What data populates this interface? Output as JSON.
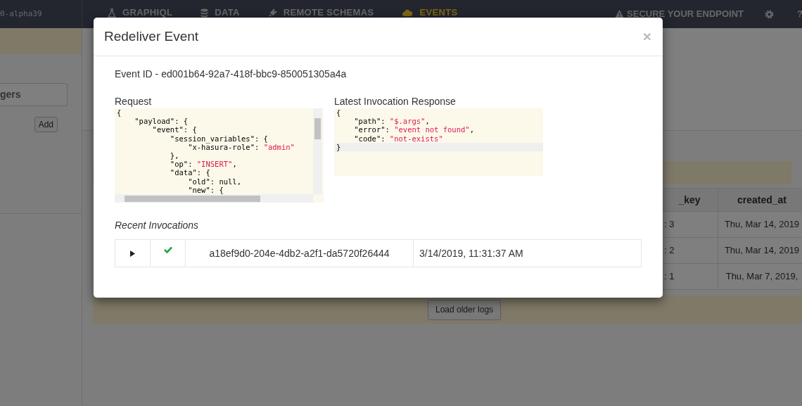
{
  "navbar": {
    "version": "0-alpha39",
    "items": [
      {
        "label": "GRAPHIQL",
        "kind": "flask",
        "selected": false
      },
      {
        "label": "DATA",
        "kind": "database",
        "selected": false
      },
      {
        "label": "REMOTE SCHEMAS",
        "kind": "plug",
        "selected": false
      },
      {
        "label": "EVENTS",
        "kind": "cloud",
        "selected": true
      }
    ],
    "secure_link": "SECURE YOUR ENDPOINT",
    "help": "?"
  },
  "sidebar": {
    "search_text": "gers",
    "add_button": "Add"
  },
  "events_table": {
    "columns": [
      "_key",
      "created_at"
    ],
    "rows": [
      [
        ": 3",
        "Thu, Mar 14, 2019"
      ],
      [
        ": 2",
        "Thu, Mar 14, 2019"
      ],
      [
        ": 1",
        "Thu, Mar 7, 2019, "
      ]
    ],
    "load_button": "Load older logs"
  },
  "modal": {
    "title": "Redeliver Event",
    "close": "×",
    "event_id": "Event ID - ed001b64-92a7-418f-bbc9-850051305a4a",
    "request_label": "Request",
    "request_lines": [
      {
        "active": false,
        "parts": [
          {
            "kind": "plain",
            "text": "{"
          }
        ]
      },
      {
        "active": false,
        "parts": [
          {
            "kind": "plain",
            "text": "    \"payload\": {"
          }
        ]
      },
      {
        "active": false,
        "parts": [
          {
            "kind": "plain",
            "text": "        \"event\": {"
          }
        ]
      },
      {
        "active": false,
        "parts": [
          {
            "kind": "plain",
            "text": "            \"session_variables\": {"
          }
        ]
      },
      {
        "active": false,
        "parts": [
          {
            "kind": "plain",
            "text": "                \"x-hasura-role\": "
          },
          {
            "kind": "string",
            "text": "\"admin\""
          }
        ]
      },
      {
        "active": false,
        "parts": [
          {
            "kind": "plain",
            "text": "            },"
          }
        ]
      },
      {
        "active": false,
        "parts": [
          {
            "kind": "plain",
            "text": "            \"op\": "
          },
          {
            "kind": "string",
            "text": "\"INSERT\""
          },
          {
            "kind": "plain",
            "text": ","
          }
        ]
      },
      {
        "active": false,
        "parts": [
          {
            "kind": "plain",
            "text": "            \"data\": {"
          }
        ]
      },
      {
        "active": false,
        "parts": [
          {
            "kind": "plain",
            "text": "                \"old\": null,"
          }
        ]
      },
      {
        "active": false,
        "parts": [
          {
            "kind": "plain",
            "text": "                \"new\": {"
          }
        ]
      }
    ],
    "response_label": "Latest Invocation Response",
    "response_lines": [
      {
        "active": false,
        "parts": [
          {
            "kind": "plain",
            "text": "{"
          }
        ]
      },
      {
        "active": false,
        "parts": [
          {
            "kind": "plain",
            "text": "    \"path\": "
          },
          {
            "kind": "string",
            "text": "\"$.args\""
          },
          {
            "kind": "plain",
            "text": ","
          }
        ]
      },
      {
        "active": false,
        "parts": [
          {
            "kind": "plain",
            "text": "    \"error\": "
          },
          {
            "kind": "string",
            "text": "\"event not found\""
          },
          {
            "kind": "plain",
            "text": ","
          }
        ]
      },
      {
        "active": false,
        "parts": [
          {
            "kind": "plain",
            "text": "    \"code\": "
          },
          {
            "kind": "string",
            "text": "\"not-exists\""
          }
        ]
      },
      {
        "active": true,
        "parts": [
          {
            "kind": "plain",
            "text": "}"
          }
        ]
      }
    ],
    "invocations_label": "Recent Invocations",
    "invocations": [
      {
        "success": true,
        "id": "a18ef9d0-204e-4db2-a2f1-da5720f26444",
        "time": "3/14/2019, 11:31:37 AM"
      }
    ]
  }
}
